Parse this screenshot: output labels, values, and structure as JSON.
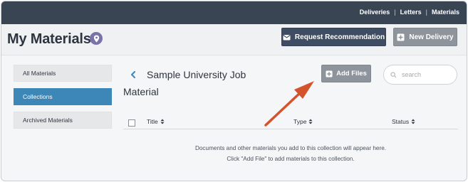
{
  "topnav": {
    "items": [
      "Deliveries",
      "Letters",
      "Materials"
    ]
  },
  "header": {
    "title": "My Materials",
    "request_button": "Request Recommendation",
    "new_delivery_button": "New Delivery"
  },
  "sidebar": {
    "items": [
      {
        "label": "All Materials",
        "active": false
      },
      {
        "label": "Collections",
        "active": true
      },
      {
        "label": "Archived Materials",
        "active": false
      }
    ]
  },
  "collection": {
    "title_line1": "Sample University Job",
    "title_line2": "Material",
    "add_files_button": "Add Files",
    "search_placeholder": "search"
  },
  "table": {
    "columns": [
      "Title",
      "Type",
      "Status"
    ]
  },
  "empty_state": {
    "line1": "Documents and other materials you add to this collection will appear here.",
    "line2": "Click \"Add File\" to add materials to this collection."
  },
  "colors": {
    "topbar": "#3a4553",
    "accent": "#3d87b8",
    "annotation_arrow": "#d4532c"
  },
  "icons": [
    "location-pin-icon",
    "envelope-icon",
    "plus-box-icon",
    "chevron-left-icon",
    "search-icon",
    "sort-icon"
  ]
}
